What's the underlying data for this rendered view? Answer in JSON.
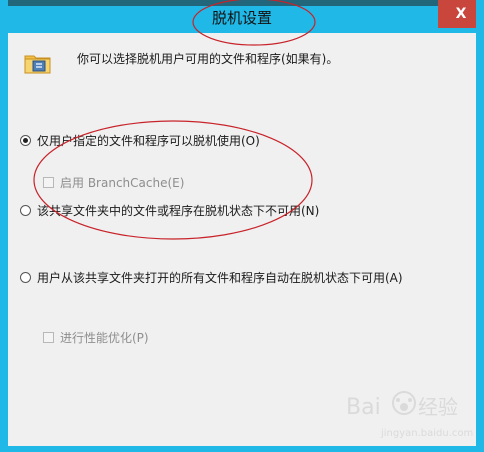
{
  "window": {
    "title": "脱机设置",
    "close_glyph": "X"
  },
  "header": {
    "icon": "offline-folder-icon",
    "description": "你可以选择脱机用户可用的文件和程序(如果有)。"
  },
  "options": [
    {
      "label": "仅用户指定的文件和程序可以脱机使用(O)",
      "selected": true
    },
    {
      "label": "该共享文件夹中的文件或程序在脱机状态下不可用(N)",
      "selected": false
    },
    {
      "label": "用户从该共享文件夹打开的所有文件和程序自动在脱机状态下可用(A)",
      "selected": false
    }
  ],
  "checkboxes": [
    {
      "label": "启用 BranchCache(E)",
      "checked": false,
      "enabled": false
    },
    {
      "label": "进行性能优化(P)",
      "checked": false,
      "enabled": false
    }
  ],
  "watermark": {
    "brand": "Baidu",
    "domain": "jingyan.baidu.com"
  },
  "colors": {
    "accent": "#20b8e6",
    "annotation": "#c8232a",
    "close": "#c9463d"
  }
}
